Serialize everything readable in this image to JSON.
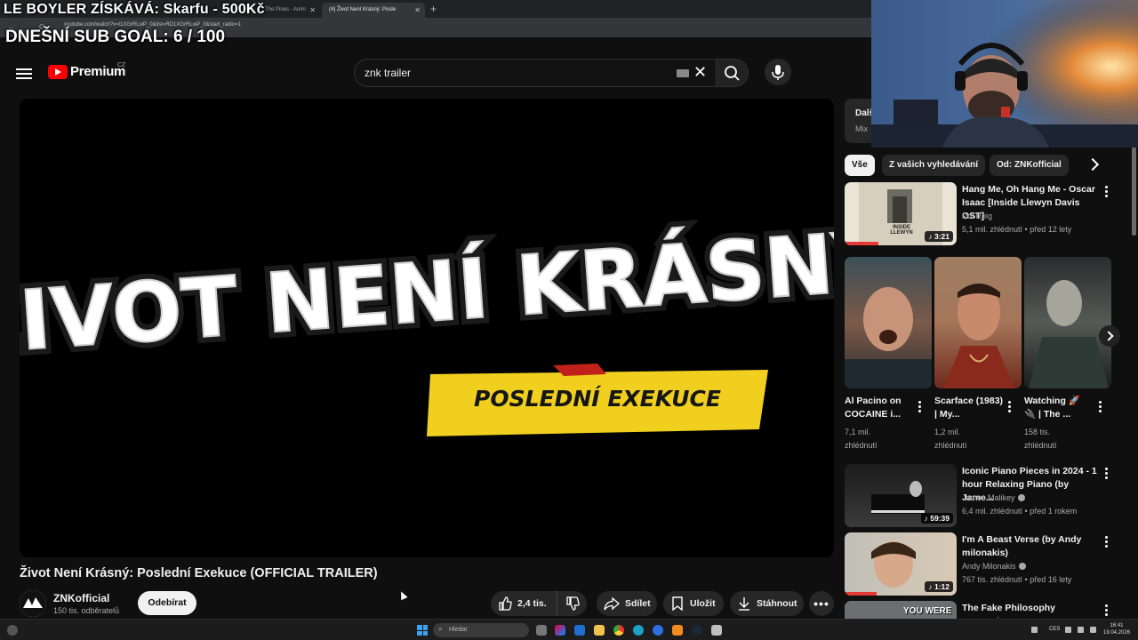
{
  "stream_overlay": {
    "line1": "LE BOYLER ZÍSKÁVÁ: Skarfu - 500Kč",
    "line2": "DNEŠNÍ SUB GOAL: 6 / 100"
  },
  "browser": {
    "tabs": [
      {
        "label": "The Pines - Anim"
      },
      {
        "label": "(4) Život Není Krásný: Posle"
      }
    ],
    "url": "youtube.com/watch?v=l1XGrRLwP_0&list=RD1XGrRLwP_0&start_radio=1"
  },
  "header": {
    "logo_text": "Premium",
    "country": "CZ",
    "search_value": "znk trailer"
  },
  "video": {
    "artwork_line1": "ŽIVOT NENÍ KRÁSNÝ",
    "artwork_line2": "POSLEDNÍ EXEKUCE",
    "title": "Život Není Krásný: Poslední Exekuce (OFFICIAL TRAILER)",
    "channel": "ZNKofficial",
    "subscribers": "150 tis. odběratelů",
    "subscribe_label": "Odebírat",
    "likes": "2,4 tis.",
    "share_label": "Sdílet",
    "save_label": "Uložit",
    "download_label": "Stáhnout"
  },
  "sidebar": {
    "mix_title": "Další",
    "mix_sub": "Mix",
    "chips": [
      "Vše",
      "Z vašich vyhledávání",
      "Od: ZNKofficial"
    ],
    "items": [
      {
        "title": "Hang Me, Oh Hang Me - Oscar Isaac [Inside Llewyn Davis OST]",
        "channel": "Pol Roig",
        "meta": "5,1 mil. zhlédnutí • před 12 lety",
        "duration": "3:21",
        "thumb_text": "INSIDE LLEWYN"
      },
      {
        "title": "Iconic Piano Pieces in 2024 - 1 hour Relaxing Piano (by Jame...",
        "channel": "James Malikey",
        "meta": "6,4 mil. zhlédnutí • před 1 rokem",
        "duration": "59:39"
      },
      {
        "title": "I'm A Beast Verse (by Andy milonakis)",
        "channel": "Andy Milonakis",
        "meta": "767 tis. zhlédnutí • před 16 lety",
        "duration": "1:12"
      },
      {
        "title": "The Fake Philosophy Destroying M...",
        "thumb_text": "YOU WERE"
      }
    ],
    "shorts": [
      {
        "title": "Al Pacino on COCAINE i...",
        "views": "7,1 mil.",
        "views_label": "zhlédnutí"
      },
      {
        "title": "Scarface (1983) | My...",
        "views": "1,2 mil.",
        "views_label": "zhlédnutí"
      },
      {
        "title": "Watching 🚀 🔌 | The ...",
        "views": "158 tis.",
        "views_label": "zhlédnutí"
      }
    ]
  },
  "taskbar": {
    "search_placeholder": "Hledat",
    "lang": "CES",
    "time": "16:41",
    "date": "19.04.2026"
  }
}
